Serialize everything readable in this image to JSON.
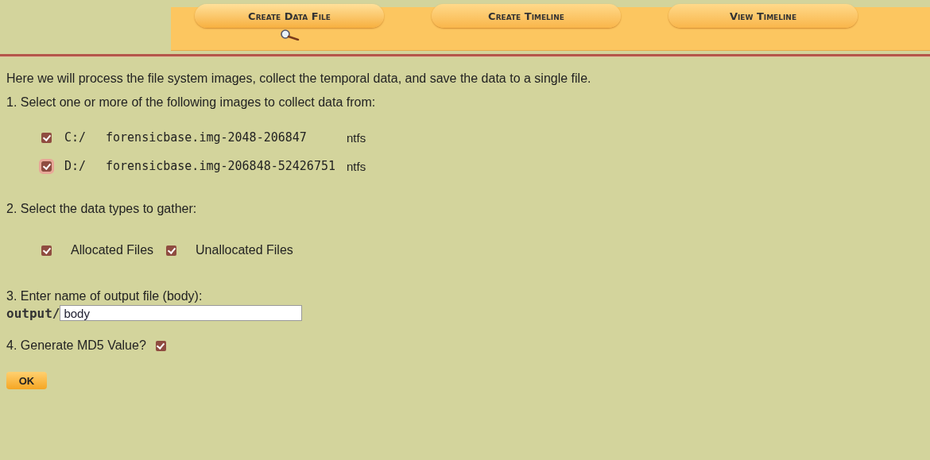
{
  "tabs": [
    {
      "label": "Create Data File",
      "selected": true
    },
    {
      "label": "Create Timeline",
      "selected": false
    },
    {
      "label": "View Timeline",
      "selected": false
    }
  ],
  "intro": "Here we will process the file system images, collect the temporal data, and save the data to a single file.",
  "step1": {
    "label": "1. Select one or more of the following images to collect data from:",
    "images": [
      {
        "drive": "C:/",
        "file": "forensicbase.img-2048-206847",
        "fs": "ntfs",
        "checked": true
      },
      {
        "drive": "D:/",
        "file": "forensicbase.img-206848-52426751",
        "fs": "ntfs",
        "checked": true
      }
    ]
  },
  "step2": {
    "label": "2. Select the data types to gather:",
    "types": [
      {
        "label": "Allocated Files",
        "checked": true
      },
      {
        "label": "Unallocated Files",
        "checked": true
      }
    ]
  },
  "step3": {
    "label": "3. Enter name of output file (body):",
    "prefix": "output/",
    "value": "body"
  },
  "step4": {
    "label": "4. Generate MD5 Value?",
    "checked": true
  },
  "ok_button": "OK"
}
